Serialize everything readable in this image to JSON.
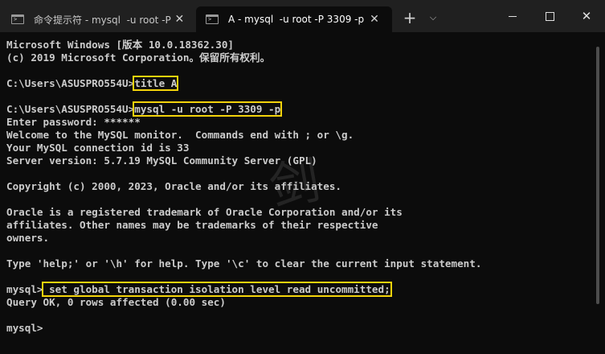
{
  "tabs": [
    {
      "label": "命令提示符 - mysql  -u root -P",
      "active": false
    },
    {
      "label": "A - mysql  -u root -P 3309 -p",
      "active": true
    }
  ],
  "icons": {
    "tab_icon": "terminal-icon",
    "close": "close-icon",
    "new_tab": "plus-icon",
    "dropdown": "chevron-down-icon",
    "minimize": "minimize-icon",
    "maximize": "maximize-icon",
    "window_close": "close-icon"
  },
  "colors": {
    "highlight": "#f3d30b",
    "text": "#cccccc",
    "background": "#0c0c0c"
  },
  "terminal": {
    "lines": [
      "Microsoft Windows [版本 10.0.18362.30]",
      "(c) 2019 Microsoft Corporation。保留所有权利。",
      "",
      "C:\\Users\\ASUSPRO554U>title A",
      "",
      "C:\\Users\\ASUSPRO554U>mysql -u root -P 3309 -p",
      "Enter password: ******",
      "Welcome to the MySQL monitor.  Commands end with ; or \\g.",
      "Your MySQL connection id is 33",
      "Server version: 5.7.19 MySQL Community Server (GPL)",
      "",
      "Copyright (c) 2000, 2023, Oracle and/or its affiliates.",
      "",
      "Oracle is a registered trademark of Oracle Corporation and/or its",
      "affiliates. Other names may be trademarks of their respective",
      "owners.",
      "",
      "Type 'help;' or '\\h' for help. Type '\\c' to clear the current input statement.",
      "",
      "mysql> set global transaction isolation level read uncommitted;",
      "Query OK, 0 rows affected (0.00 sec)",
      "",
      "mysql>"
    ],
    "prompt1": "C:\\Users\\ASUSPRO554U>",
    "cmd1": "title A",
    "prompt2": "C:\\Users\\ASUSPRO554U>",
    "cmd2": "mysql -u root -P 3309 -p",
    "prompt3": "mysql>",
    "cmd3": " set global transaction isolation level read uncommitted;"
  }
}
